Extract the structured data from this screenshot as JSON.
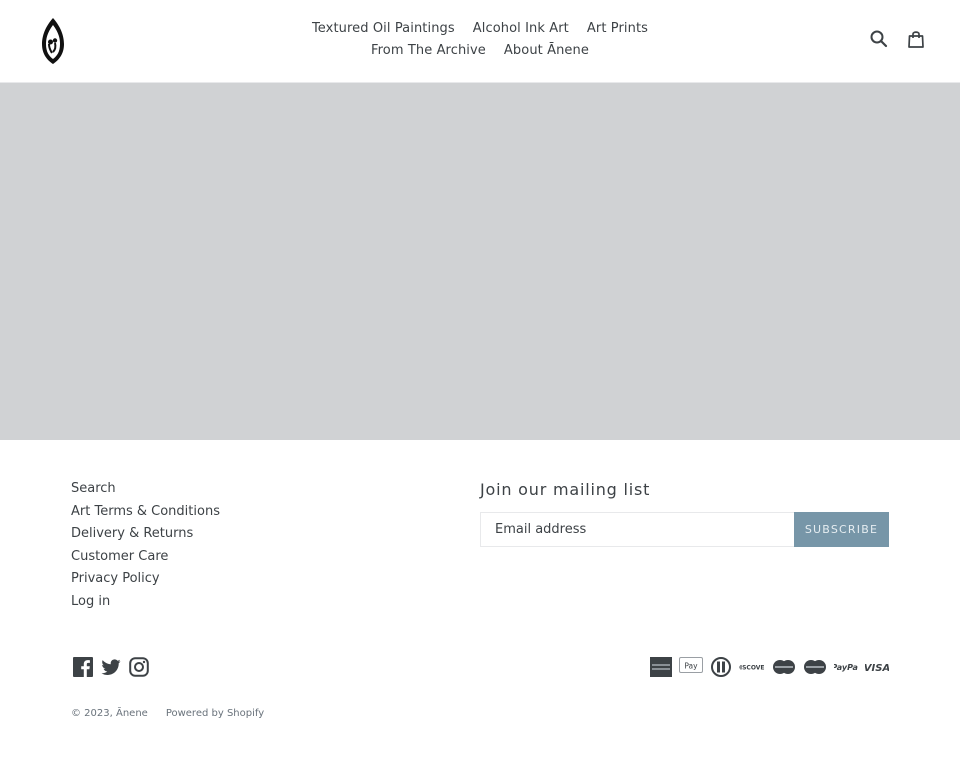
{
  "header": {
    "logo_alt": "Ānene logo",
    "nav_row1": [
      "Textured Oil Paintings",
      "Alcohol Ink Art",
      "Art Prints"
    ],
    "nav_row2": [
      "From The Archive",
      "About Ānene"
    ],
    "icons": [
      "search-icon",
      "cart-icon"
    ]
  },
  "hero": {
    "background": "#d0d2d4"
  },
  "footer": {
    "links": [
      "Search",
      "Art Terms & Conditions",
      "Delivery & Returns",
      "Customer Care",
      "Privacy Policy",
      "Log in"
    ],
    "mailing": {
      "title": "Join our mailing list",
      "placeholder": "Email address",
      "subscribe_label": "SUBSCRIBE",
      "button_color": "#7796a8"
    },
    "social": [
      "facebook-icon",
      "twitter-icon",
      "instagram-icon"
    ],
    "payments": [
      "American Express",
      "Apple Pay",
      "Diners Club",
      "Discover",
      "Maestro",
      "Mastercard",
      "PayPal",
      "Visa"
    ],
    "copyright": "© 2023, Ānene",
    "powered_by": "Powered by Shopify"
  }
}
